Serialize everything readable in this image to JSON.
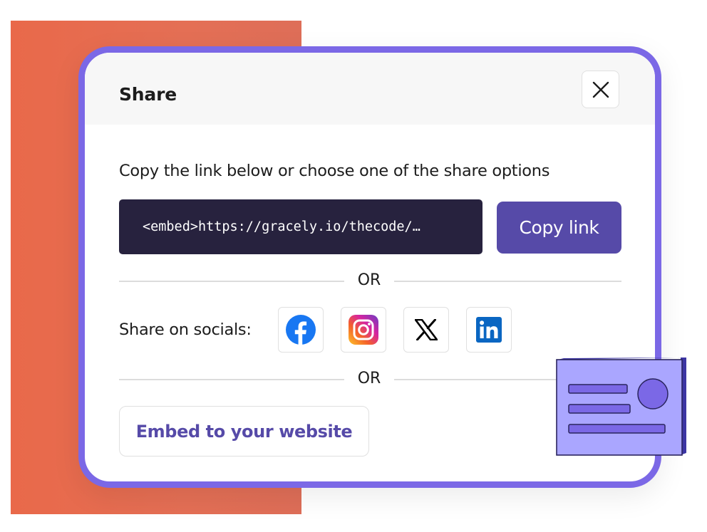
{
  "dialog": {
    "title": "Share",
    "close_icon": "close-icon",
    "instruction": "Copy the link below or choose one of the share options",
    "link_value": "<embed>https://gracely.io/thecode/…",
    "copy_button_label": "Copy link",
    "divider_label_1": "OR",
    "social_label": "Share on socials:",
    "socials": [
      {
        "name": "facebook",
        "icon": "facebook-icon",
        "color": "#1877f2"
      },
      {
        "name": "instagram",
        "icon": "instagram-icon",
        "color": "#d6249f"
      },
      {
        "name": "x",
        "icon": "x-icon",
        "color": "#000000"
      },
      {
        "name": "linkedin",
        "icon": "linkedin-icon",
        "color": "#0a66c2"
      }
    ],
    "divider_label_2": "OR",
    "embed_button_label": "Embed to your website"
  },
  "colors": {
    "accent_border": "#7b68e6",
    "primary_button": "#564aa8",
    "link_box_bg": "#27223e",
    "background_block": "#e9694a",
    "card_illustration": "#aaa6ff"
  }
}
